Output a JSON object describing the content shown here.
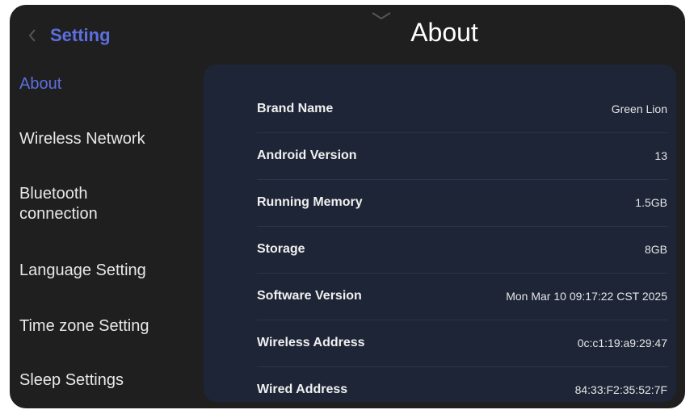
{
  "sidebar": {
    "title": "Setting",
    "back_icon": "chevron-left-icon",
    "items": [
      {
        "label": "About",
        "active": true
      },
      {
        "label": "Wireless Network",
        "active": false
      },
      {
        "label": "Bluetooth connection",
        "active": false
      },
      {
        "label": "Language Setting",
        "active": false
      },
      {
        "label": "Time zone Setting",
        "active": false
      },
      {
        "label": "Sleep Settings",
        "active": false
      }
    ]
  },
  "header": {
    "title": "About",
    "pull_icon": "chevron-down-icon"
  },
  "info": {
    "rows": [
      {
        "label": "Brand Name",
        "value": "Green Lion"
      },
      {
        "label": "Android Version",
        "value": "13"
      },
      {
        "label": "Running Memory",
        "value": "1.5GB"
      },
      {
        "label": "Storage",
        "value": "8GB"
      },
      {
        "label": "Software Version",
        "value": "Mon Mar 10 09:17:22 CST 2025"
      },
      {
        "label": "Wireless Address",
        "value": "0c:c1:19:a9:29:47"
      },
      {
        "label": "Wired Address",
        "value": "84:33:F2:35:52:7F"
      }
    ]
  },
  "colors": {
    "accent": "#5c6ee0",
    "background": "#1f1f1f",
    "panel": "#1d2536"
  }
}
